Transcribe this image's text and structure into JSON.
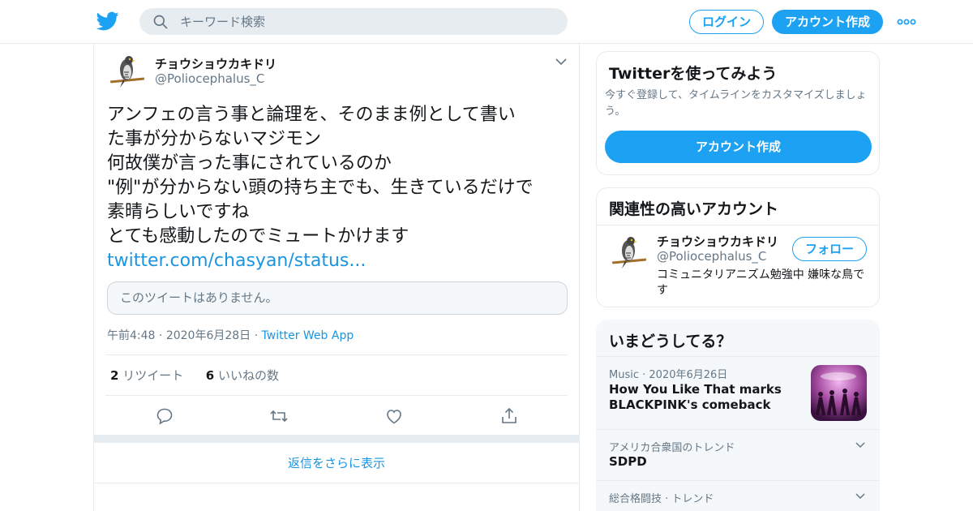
{
  "header": {
    "logo_icon": "twitter-bird-icon",
    "search_placeholder": "キーワード検索",
    "login_label": "ログイン",
    "signup_label": "アカウント作成",
    "more_icon": "more-dots-icon"
  },
  "tweet": {
    "name": "チョウショウカキドリ",
    "handle": "@Poliocephalus_C",
    "lines": [
      "アンフェの言う事と論理を、そのまま例として書い",
      "た事が分からないマジモン",
      "何故僕が言った事にされているのか",
      "\"例\"が分からない頭の持ち主でも、生きているだけで",
      "素晴らしいですね",
      "とても感動したのでミュートかけます"
    ],
    "link": "twitter.com/chasyan/status...",
    "quote_unavailable": "このツイートはありません。",
    "time": "午前4:48",
    "date": "2020年6月28日",
    "app": "Twitter Web App",
    "retweet_count": "2",
    "retweet_label": "リツイート",
    "like_count": "6",
    "like_label": "いいねの数",
    "show_more_replies": "返信をさらに表示"
  },
  "signup_card": {
    "title": "Twitterを使ってみよう",
    "text": "今すぐ登録して、タイムラインをカスタマイズしましょう。",
    "button": "アカウント作成"
  },
  "related": {
    "title": "関連性の高いアカウント",
    "name": "チョウショウカキドリ",
    "handle": "@Poliocephalus_C",
    "follow": "フォロー",
    "bio": "コミュニタリアニズム勉強中 嫌味な鳥です"
  },
  "trends": {
    "title": "いまどうしてる？",
    "items": [
      {
        "category": "Music",
        "date": "2020年6月26日",
        "text": "How You Like That marks BLACKPINK's comeback"
      },
      {
        "category": "アメリカ合衆国のトレンド",
        "text": "SDPD"
      },
      {
        "category": "総合格闘技 · トレンド",
        "text": ""
      }
    ]
  },
  "colors": {
    "accent": "#1da1f2",
    "link": "#1b95e0",
    "muted": "#657786",
    "border": "#e6ecf0"
  }
}
